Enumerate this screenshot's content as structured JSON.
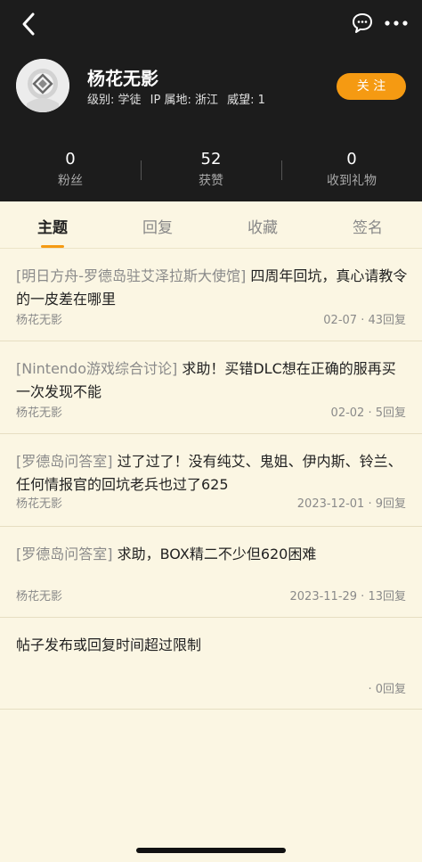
{
  "profile": {
    "name": "杨花无影",
    "level": "级别: 学徒",
    "ip": "IP 属地: 浙江",
    "prestige": "威望: 1",
    "follow_label": "关 注"
  },
  "stats": [
    {
      "value": "0",
      "label": "粉丝"
    },
    {
      "value": "52",
      "label": "获赞"
    },
    {
      "value": "0",
      "label": "收到礼物"
    }
  ],
  "tabs": [
    "主题",
    "回复",
    "收藏",
    "签名"
  ],
  "posts": [
    {
      "forum": "[明日方舟-罗德岛驻艾泽拉斯大使馆]",
      "title": " 四周年回坑，真心请教令的一皮差在哪里",
      "author": "杨花无影",
      "info": "02-07 · 43回复"
    },
    {
      "forum": "[Nintendo游戏综合讨论]",
      "title": " 求助！买错DLC想在正确的服再买一次发现不能",
      "author": "杨花无影",
      "info": "02-02 · 5回复"
    },
    {
      "forum": "[罗德岛问答室]",
      "title": " 过了过了！没有纯艾、鬼姐、伊内斯、铃兰、任何情报官的回坑老兵也过了625",
      "author": "杨花无影",
      "info": "2023-12-01 · 9回复"
    },
    {
      "forum": "[罗德岛问答室]",
      "title": " 求助，BOX精二不少但620困难",
      "author": "杨花无影",
      "info": "2023-11-29 · 13回复"
    },
    {
      "forum": "",
      "title": "帖子发布或回复时间超过限制",
      "author": "",
      "info": "· 0回复"
    }
  ]
}
